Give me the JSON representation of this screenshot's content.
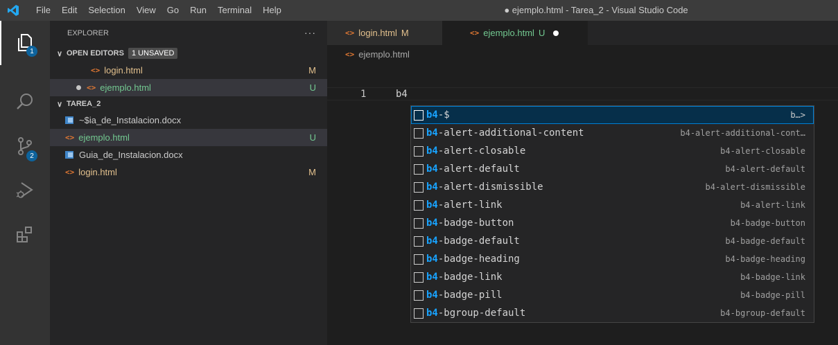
{
  "titlebar": {
    "menu": [
      "File",
      "Edit",
      "Selection",
      "View",
      "Go",
      "Run",
      "Terminal",
      "Help"
    ],
    "window_title": "● ejemplo.html - Tarea_2 - Visual Studio Code"
  },
  "activitybar": {
    "explorer_badge": "1",
    "scm_badge": "2"
  },
  "sidebar": {
    "title": "EXPLORER",
    "more": "···",
    "open_editors": {
      "label": "OPEN EDITORS",
      "badge": "1 UNSAVED",
      "items": [
        {
          "name": "login.html",
          "status": "M"
        },
        {
          "name": "ejemplo.html",
          "status": "U"
        }
      ]
    },
    "folder": {
      "label": "TAREA_2",
      "items": [
        {
          "name": "~$ia_de_Instalacion.docx",
          "status": ""
        },
        {
          "name": "ejemplo.html",
          "status": "U"
        },
        {
          "name": "Guia_de_Instalacion.docx",
          "status": ""
        },
        {
          "name": "login.html",
          "status": "M"
        }
      ]
    }
  },
  "tabs": [
    {
      "name": "login.html",
      "status": "M"
    },
    {
      "name": "ejemplo.html",
      "status": "U"
    }
  ],
  "breadcrumb": "ejemplo.html",
  "editor": {
    "line_number": "1",
    "code": "b4"
  },
  "suggest": {
    "match": "b4",
    "items": [
      {
        "rest": "-$",
        "detail": "b…>"
      },
      {
        "rest": "-alert-additional-content",
        "detail": "b4-alert-additional-cont…"
      },
      {
        "rest": "-alert-closable",
        "detail": "b4-alert-closable"
      },
      {
        "rest": "-alert-default",
        "detail": "b4-alert-default"
      },
      {
        "rest": "-alert-dismissible",
        "detail": "b4-alert-dismissible"
      },
      {
        "rest": "-alert-link",
        "detail": "b4-alert-link"
      },
      {
        "rest": "-badge-button",
        "detail": "b4-badge-button"
      },
      {
        "rest": "-badge-default",
        "detail": "b4-badge-default"
      },
      {
        "rest": "-badge-heading",
        "detail": "b4-badge-heading"
      },
      {
        "rest": "-badge-link",
        "detail": "b4-badge-link"
      },
      {
        "rest": "-badge-pill",
        "detail": "b4-badge-pill"
      },
      {
        "rest": "-bgroup-default",
        "detail": "b4-bgroup-default"
      }
    ]
  },
  "colors": {
    "accent": "#007fd4",
    "modified": "#e2c08d",
    "untracked": "#73c991"
  }
}
